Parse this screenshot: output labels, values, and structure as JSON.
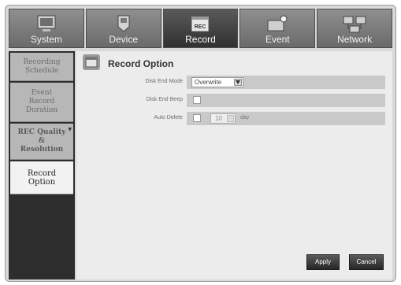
{
  "tabs": [
    {
      "label": "System",
      "icon": "system-icon"
    },
    {
      "label": "Device",
      "icon": "device-icon"
    },
    {
      "label": "Record",
      "icon": "record-icon",
      "active": true
    },
    {
      "label": "Event",
      "icon": "event-icon"
    },
    {
      "label": "Network",
      "icon": "network-icon"
    }
  ],
  "record_icon_text": "REC",
  "sidebar": {
    "items": [
      {
        "label": "Recording\nSchedule"
      },
      {
        "label": "Event\nRecord\nDuration"
      },
      {
        "label": "REC Quality\n&\nResolution"
      },
      {
        "label": "Record\nOption",
        "active": true
      }
    ]
  },
  "page": {
    "title": "Record Option",
    "disk_end_mode": {
      "label": "Disk End Mode",
      "value": "Overwrite"
    },
    "disk_end_beep": {
      "label": "Disk End Beep"
    },
    "auto_delete": {
      "label": "Auto Delete",
      "days": "10",
      "unit": "day"
    }
  },
  "buttons": {
    "apply": "Apply",
    "cancel": "Cancel"
  },
  "colors": {
    "tab_active": "#303030",
    "sidebar_bg": "#2d2d2d",
    "content_bg": "#ececec",
    "row_bg": "#c9c9c9"
  }
}
